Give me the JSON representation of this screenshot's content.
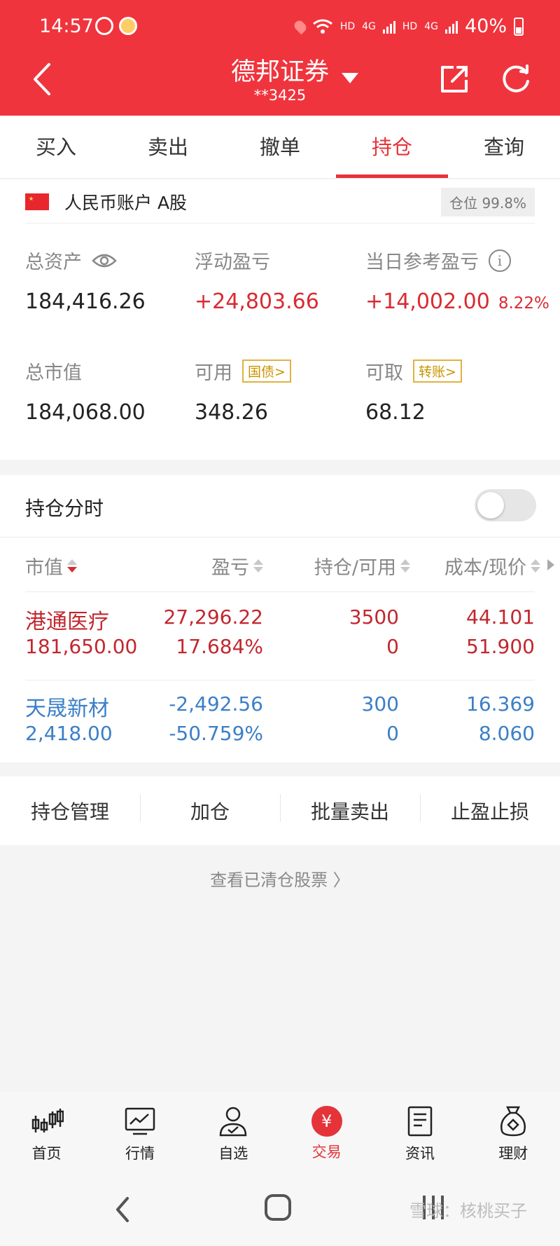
{
  "status_bar": {
    "time": "14:57",
    "battery": "40%",
    "net1": "HD",
    "net2": "4G",
    "net3": "HD",
    "net4": "4G"
  },
  "header": {
    "title": "德邦证券",
    "account_masked": "**3425"
  },
  "tabs": [
    {
      "label": "买入"
    },
    {
      "label": "卖出"
    },
    {
      "label": "撤单"
    },
    {
      "label": "持仓"
    },
    {
      "label": "查询"
    }
  ],
  "account": {
    "name": "人民币账户 A股",
    "position_label": "仓位 99.8%",
    "total_assets_label": "总资产",
    "total_assets": "184,416.26",
    "floating_pl_label": "浮动盈亏",
    "floating_pl": "+24,803.66",
    "daily_pl_label": "当日参考盈亏",
    "daily_pl": "+14,002.00",
    "daily_pl_pct": "8.22%",
    "market_value_label": "总市值",
    "market_value": "184,068.00",
    "available_label": "可用",
    "available_tag": "国债>",
    "available": "348.26",
    "withdrawable_label": "可取",
    "withdrawable_tag": "转账>",
    "withdrawable": "68.12"
  },
  "holdings": {
    "title": "持仓分时",
    "toggle_on": false,
    "columns": [
      "市值",
      "盈亏",
      "持仓/可用",
      "成本/现价"
    ],
    "rows": [
      {
        "name": "港通医疗",
        "market_value": "181,650.00",
        "pl": "27,296.22",
        "pl_pct": "17.684%",
        "qty": "3500",
        "avail": "0",
        "cost": "44.101",
        "price": "51.900",
        "color": "#c2272f"
      },
      {
        "name": "天晟新材",
        "market_value": "2,418.00",
        "pl": "-2,492.56",
        "pl_pct": "-50.759%",
        "qty": "300",
        "avail": "0",
        "cost": "16.369",
        "price": "8.060",
        "color": "#3b7fc7"
      }
    ]
  },
  "actions": [
    {
      "label": "持仓管理"
    },
    {
      "label": "加仓"
    },
    {
      "label": "批量卖出"
    },
    {
      "label": "止盈止损"
    }
  ],
  "cleared_link": "查看已清仓股票 〉",
  "bottom_nav": [
    {
      "label": "首页",
      "icon": "candlestick-icon"
    },
    {
      "label": "行情",
      "icon": "chart-monitor-icon"
    },
    {
      "label": "自选",
      "icon": "user-check-icon"
    },
    {
      "label": "交易",
      "icon": "yen-icon"
    },
    {
      "label": "资讯",
      "icon": "document-icon"
    },
    {
      "label": "理财",
      "icon": "money-bag-icon"
    }
  ],
  "watermark": "雪球：核桃买子",
  "colors": {
    "brand": "#f0343d",
    "up": "#c2272f",
    "down": "#3b7fc7",
    "tag": "#c99400"
  }
}
